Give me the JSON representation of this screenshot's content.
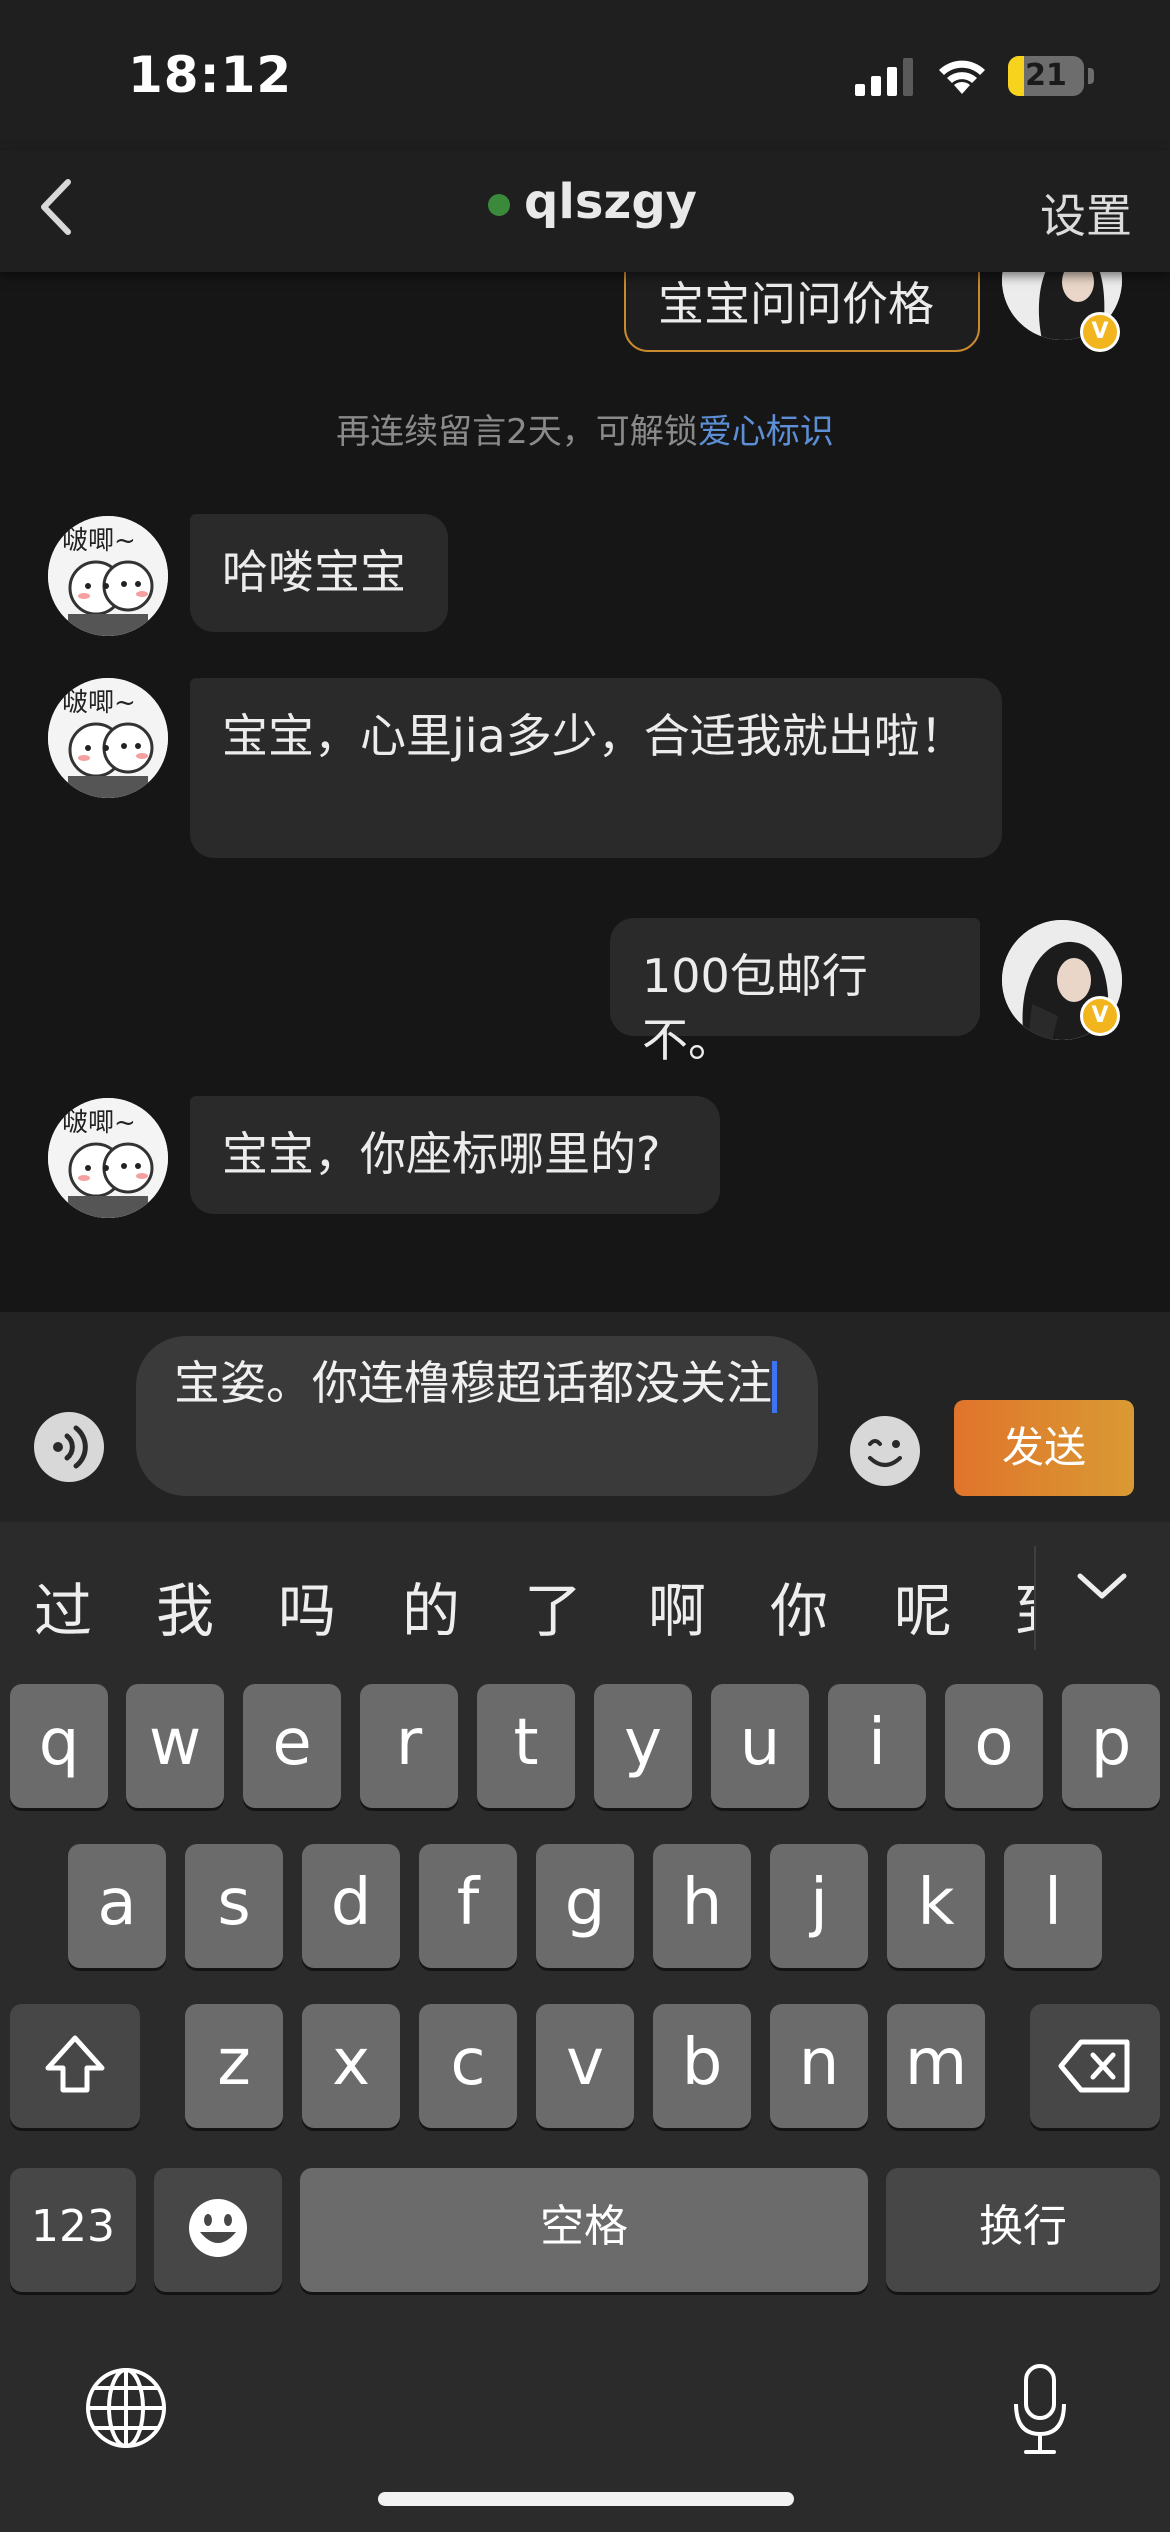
{
  "status_bar": {
    "time": "18:12",
    "battery_percent": "21",
    "battery_level": 0.21
  },
  "nav": {
    "title": "qlszgy",
    "online": true,
    "right_action": "设置"
  },
  "chat": {
    "partial_top_message": "宝宝问问价格",
    "system_note": {
      "text": "再连续留言2天，可解锁",
      "link": "爱心标识"
    },
    "messages": [
      {
        "side": "in",
        "text": "哈喽宝宝",
        "avatar_text": "啵唧~"
      },
      {
        "side": "in",
        "text": "宝宝，心里jia多少，合适我就出啦！",
        "avatar_text": "啵唧~"
      },
      {
        "side": "out",
        "text": "100包邮行不。",
        "verified": "V"
      },
      {
        "side": "in",
        "text": "宝宝，你座标哪里的?",
        "avatar_text": "啵唧~"
      }
    ]
  },
  "composer": {
    "draft": "宝姿。你连橹穆超话都没关注",
    "send_label": "发送"
  },
  "keyboard": {
    "candidates": [
      "过",
      "我",
      "吗",
      "的",
      "了",
      "啊",
      "你",
      "呢",
      "到"
    ],
    "row1": [
      "q",
      "w",
      "e",
      "r",
      "t",
      "y",
      "u",
      "i",
      "o",
      "p"
    ],
    "row2": [
      "a",
      "s",
      "d",
      "f",
      "g",
      "h",
      "j",
      "k",
      "l"
    ],
    "row3": [
      "z",
      "x",
      "c",
      "v",
      "b",
      "n",
      "m"
    ],
    "numbers_label": "123",
    "space_label": "空格",
    "return_label": "换行"
  },
  "colors": {
    "send_start": "#e0742b",
    "send_end": "#d99a33",
    "link": "#5d8fd6",
    "caret": "#3d74f5",
    "online": "#3b8a3b",
    "badge": "#f2b51d"
  }
}
